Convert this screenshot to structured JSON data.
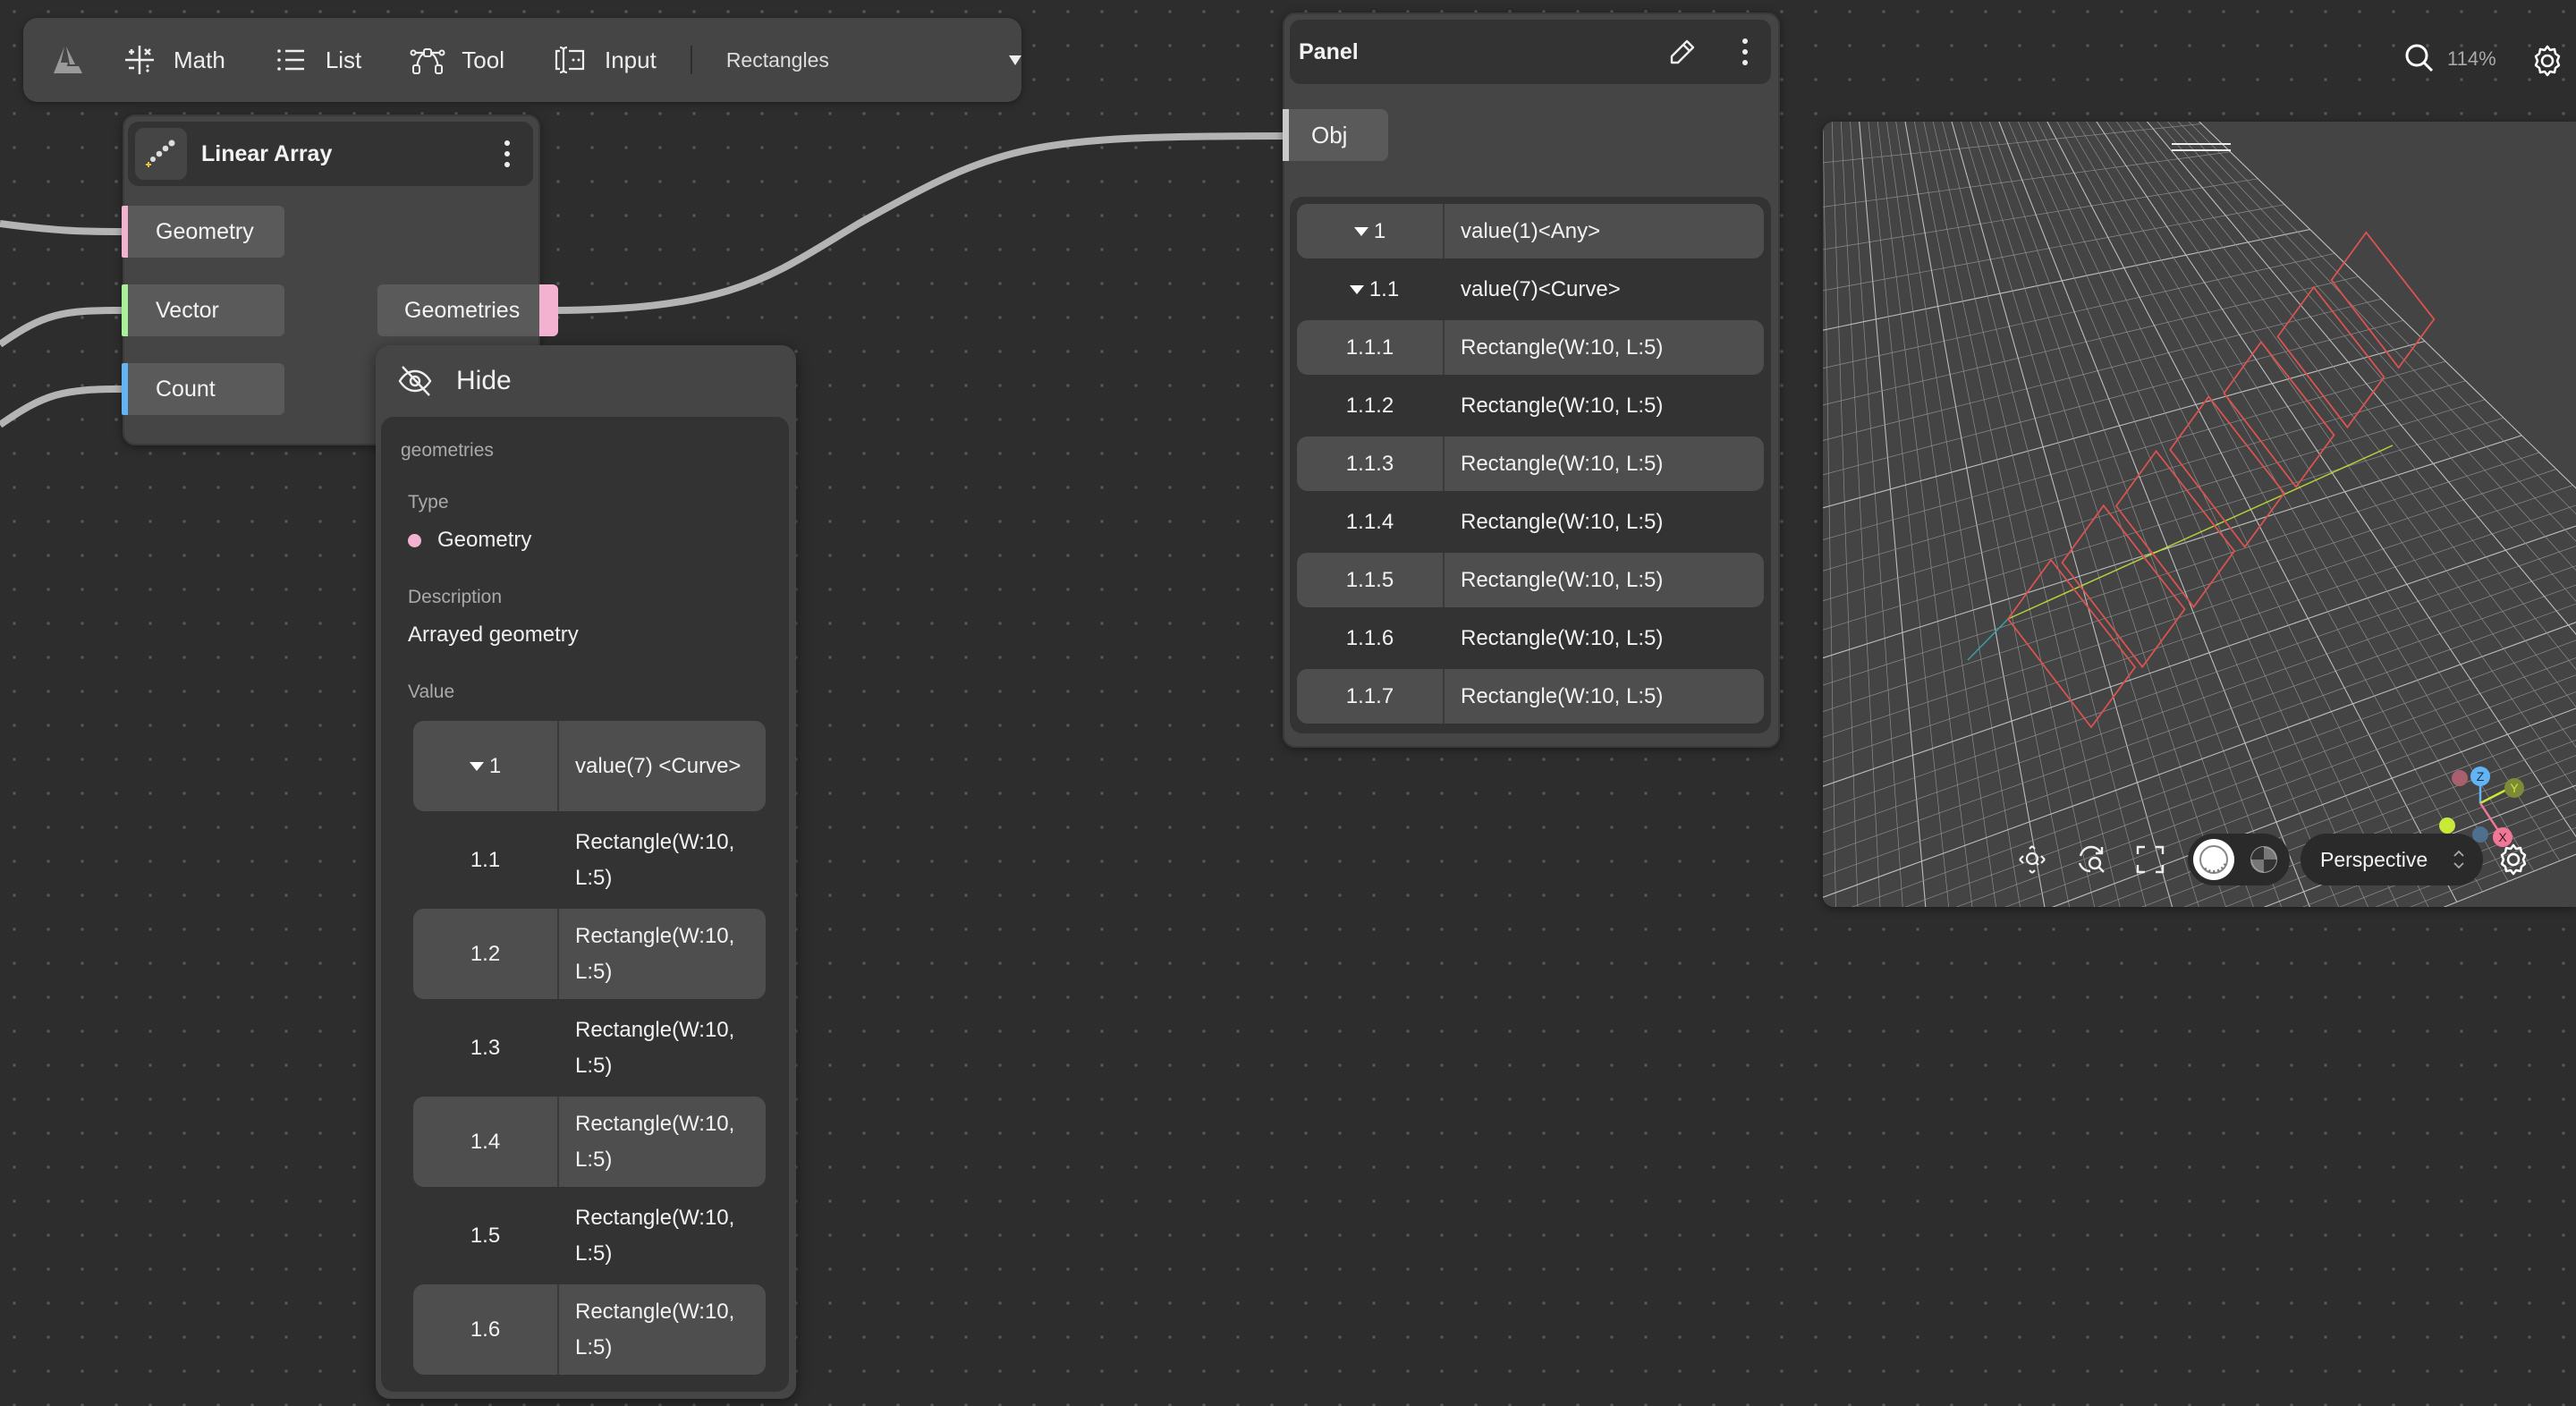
{
  "toolbar": {
    "logo_icon": "app-logo-icon",
    "items": [
      {
        "label": "Math",
        "icon": "math-operators-icon"
      },
      {
        "label": "List",
        "icon": "list-icon"
      },
      {
        "label": "Tool",
        "icon": "bezier-tool-icon"
      },
      {
        "label": "Input",
        "icon": "text-input-icon"
      }
    ],
    "preset_select": {
      "value": "Rectangles",
      "icon": "caret-down-icon"
    }
  },
  "top_right": {
    "zoom_icon": "search-icon",
    "zoom_level": "114%",
    "settings_icon": "gear-icon"
  },
  "linear_array_node": {
    "title": "Linear Array",
    "icon": "linear-array-icon",
    "menu_icon": "kebab-menu-icon",
    "inputs": [
      {
        "label": "Geometry",
        "color": "#f2b2d0"
      },
      {
        "label": "Vector",
        "color": "#a8f09a"
      },
      {
        "label": "Count",
        "color": "#62b4f5"
      }
    ],
    "outputs": [
      {
        "label": "Geometries",
        "color": "#f2b2d0"
      }
    ]
  },
  "port_popup": {
    "hide_label": "Hide",
    "hide_icon": "eye-off-icon",
    "port_name": "geometries",
    "type_label": "Type",
    "type_value": "Geometry",
    "type_color": "#f2b2d0",
    "description_label": "Description",
    "description_value": "Arrayed geometry",
    "value_label": "Value",
    "rows": [
      {
        "key": "1",
        "value": "value(7) <Curve>",
        "expanded": true,
        "shaded": true
      },
      {
        "key": "1.1",
        "value": "Rectangle(W:10, L:5)",
        "shaded": false
      },
      {
        "key": "1.2",
        "value": "Rectangle(W:10, L:5)",
        "shaded": true
      },
      {
        "key": "1.3",
        "value": "Rectangle(W:10, L:5)",
        "shaded": false
      },
      {
        "key": "1.4",
        "value": "Rectangle(W:10, L:5)",
        "shaded": true
      },
      {
        "key": "1.5",
        "value": "Rectangle(W:10, L:5)",
        "shaded": false
      },
      {
        "key": "1.6",
        "value": "Rectangle(W:10, L:5)",
        "shaded": true
      }
    ]
  },
  "panel_node": {
    "title": "Panel",
    "edit_icon": "pencil-icon",
    "menu_icon": "kebab-menu-icon",
    "input": {
      "label": "Obj",
      "color": "#c9c9c9"
    },
    "rows": [
      {
        "key": "1",
        "value": "value(1)<Any>",
        "expanded": true,
        "shaded": true
      },
      {
        "key": "1.1",
        "value": "value(7)<Curve>",
        "expanded": true,
        "shaded": false
      },
      {
        "key": "1.1.1",
        "value": "Rectangle(W:10, L:5)",
        "shaded": true
      },
      {
        "key": "1.1.2",
        "value": "Rectangle(W:10, L:5)",
        "shaded": false
      },
      {
        "key": "1.1.3",
        "value": "Rectangle(W:10, L:5)",
        "shaded": true
      },
      {
        "key": "1.1.4",
        "value": "Rectangle(W:10, L:5)",
        "shaded": false
      },
      {
        "key": "1.1.5",
        "value": "Rectangle(W:10, L:5)",
        "shaded": true
      },
      {
        "key": "1.1.6",
        "value": "Rectangle(W:10, L:5)",
        "shaded": false
      },
      {
        "key": "1.1.7",
        "value": "Rectangle(W:10, L:5)",
        "shaded": true
      }
    ]
  },
  "viewport": {
    "drag_handle_icon": "drag-handle-icon",
    "rectangle_count": 7,
    "rectangle_color": "#d9534f",
    "axis_colors": {
      "x": "#f07896",
      "y": "#c8e83a",
      "z": "#62b4f5"
    },
    "gizmo_labels": {
      "x": "X",
      "y": "Y",
      "z": "Z"
    },
    "controls": {
      "zoom_extents_icon": "zoom-extents-icon",
      "zoom_refresh_icon": "zoom-refresh-icon",
      "fullscreen_icon": "fullscreen-icon",
      "shaded_mode_icon": "shaded-sphere-icon",
      "wire_mode_icon": "xray-sphere-icon",
      "camera_mode": "Perspective",
      "camera_mode_icon": "updown-chevron-icon",
      "settings_icon": "gear-icon"
    }
  }
}
